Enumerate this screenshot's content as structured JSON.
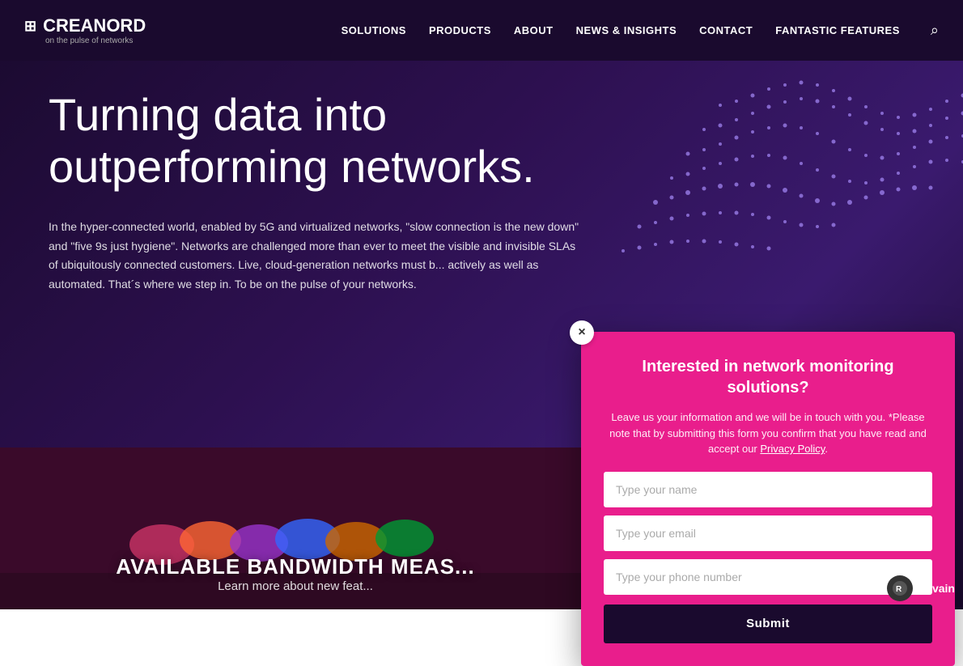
{
  "header": {
    "logo_name": "CREANORD",
    "logo_tagline": "on the pulse of networks",
    "nav_items": [
      {
        "label": "SOLUTIONS",
        "id": "solutions"
      },
      {
        "label": "PRODUCTS",
        "id": "products"
      },
      {
        "label": "ABOUT",
        "id": "about"
      },
      {
        "label": "NEWS & INSIGHTS",
        "id": "news-insights"
      },
      {
        "label": "CONTACT",
        "id": "contact"
      },
      {
        "label": "FANTASTIC FEATURES",
        "id": "fantastic-features"
      }
    ]
  },
  "hero": {
    "title": "Turning data into outperforming networks.",
    "body": "In the hyper-connected world, enabled by 5G and virtualized networks, \"slow connection is the new down\" and \"five 9s just hygiene\". Networks are challenged more than ever to meet the visible and invisible SLAs of ubiquitously connected customers.  Live, cloud-generation networks must b... actively as well as automated. That´s where we step in. To be on the pulse of your networks."
  },
  "bottom_section": {
    "headline": "AVAILABLE BANDWIDTH MEAS...",
    "subtext": "Learn more about new feat..."
  },
  "modal": {
    "title": "Interested in network monitoring solutions?",
    "description": "Leave us your information and we will be in touch with you. *Please note that by submitting this form you confirm that you have read and accept our Privacy Policy.",
    "privacy_link": "Privacy Policy",
    "name_placeholder": "Type your name",
    "email_placeholder": "Type your email",
    "phone_placeholder": "Type your phone number",
    "submit_label": "Submit",
    "close_icon": "×"
  },
  "revain": {
    "label": "Revain"
  },
  "colors": {
    "brand_pink": "#e91e8c",
    "brand_dark": "#1a0a2e",
    "nav_bg": "#1a0a2e"
  }
}
